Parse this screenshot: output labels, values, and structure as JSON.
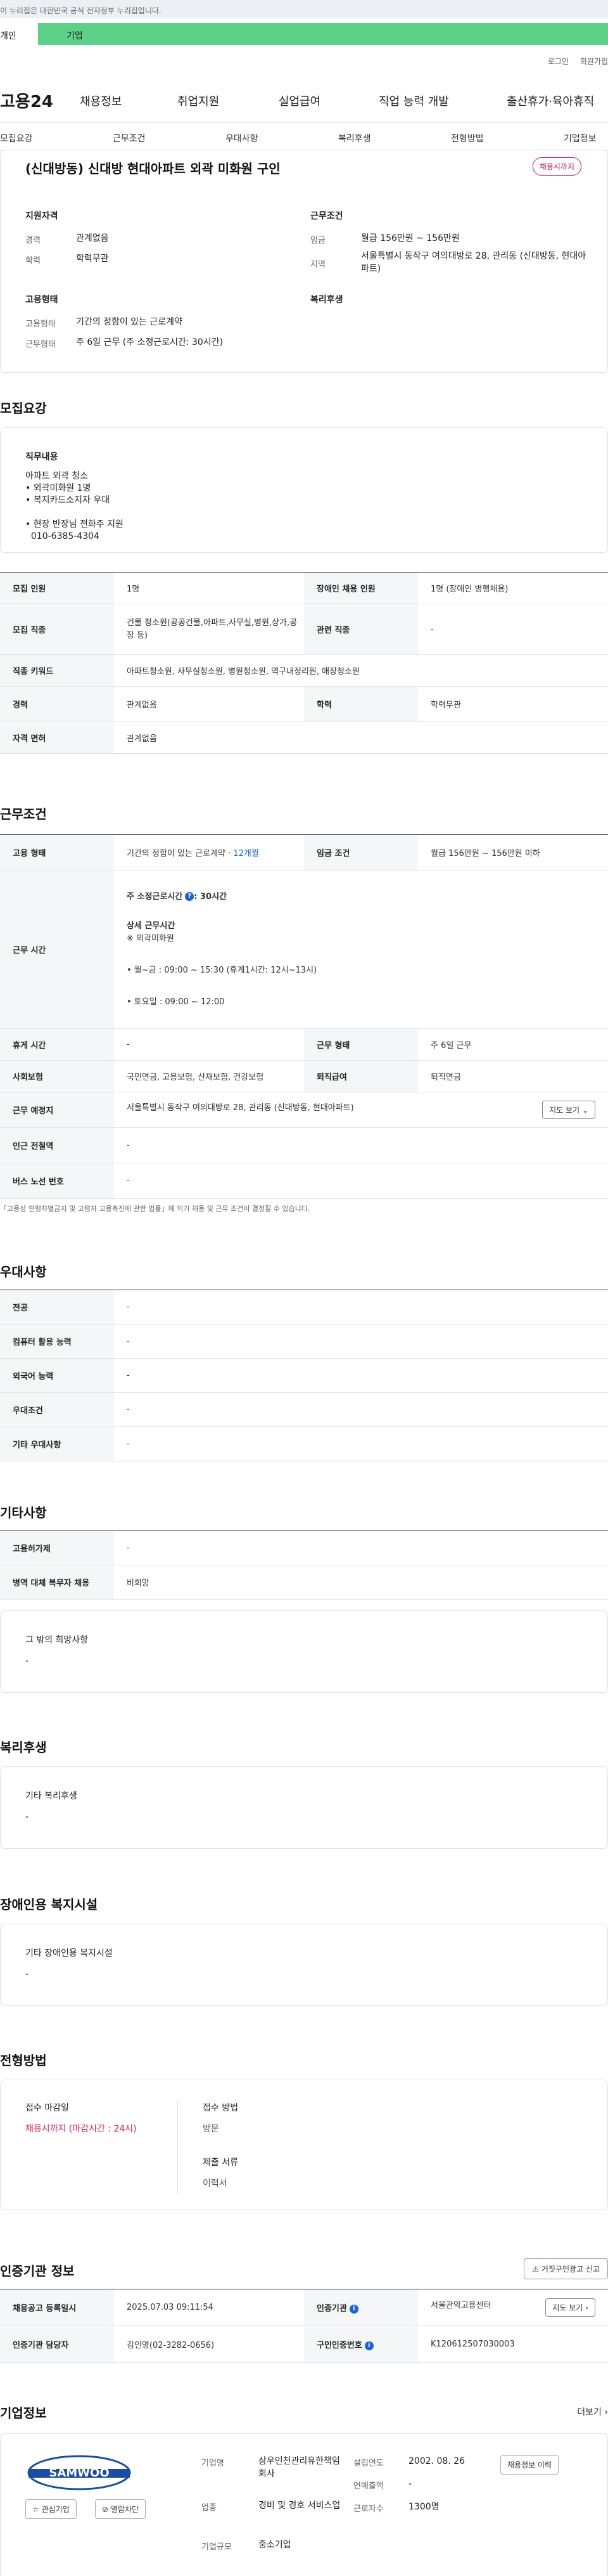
{
  "gov_banner": "이 누리집은 대한민국 공식 전자정부 누리집입니다.",
  "tabs": {
    "personal": "개인",
    "business": "기업"
  },
  "util": {
    "login": "로그인",
    "join": "회원가입"
  },
  "logo": "고용24",
  "gnb": [
    "채용정보",
    "취업지원",
    "실업급여",
    "직업 능력 개발",
    "출산휴가·육아휴직"
  ],
  "subnav": [
    "모집요강",
    "근무조건",
    "우대사항",
    "복리후생",
    "전형방법",
    "기업정보"
  ],
  "job": {
    "title": "(신대방동) 신대방 현대아파트 외곽 미화원 구인",
    "badge": "채용시까지",
    "qual_title": "지원자격",
    "career_label": "경력",
    "career": "관계없음",
    "edu_label": "학력",
    "edu": "학력무관",
    "work_title": "근무조건",
    "wage_label": "임금",
    "wage": "월급 156만원 ~ 156만원",
    "region_label": "지역",
    "region": "서울특별시 동작구 여의대방로 28, 관리동 (신대방동, 현대아파트)",
    "emp_title": "고용형태",
    "emptype_label": "고용형태",
    "emptype": "기간의 정함이 있는 근로계약",
    "worktype_label": "근무형태",
    "worktype": "주 6일 근무 (주 소정근로시간: 30시간)",
    "welfare_title": "복리후생"
  },
  "recruit": {
    "title": "모집요강",
    "duty_title": "직무내용",
    "duty_text": "아파트 외곽 청소\n• 외곽미화원 1명\n• 복지카드소지자 우대\n\n• 현장 반장님 전화주 지원\n  010-6385-4304",
    "rows": [
      {
        "k1": "모집 인원",
        "v1": "1명",
        "k2": "장애인 채용 인원",
        "v2": "1명 (장애인 병행채용)"
      },
      {
        "k1": "모집 직종",
        "v1": "건물 청소원(공공건물,아파트,사무실,병원,상가,공장 등)",
        "k2": "관련 직종",
        "v2": "-"
      },
      {
        "k1": "직종 키워드",
        "v1": "아파트청소원, 사무실청소원, 병원청소원, 역구내정리원, 매장청소원"
      },
      {
        "k1": "경력",
        "v1": "관계없음",
        "k2": "학력",
        "v2": "학력무관"
      },
      {
        "k1": "자격 면허",
        "v1": "관계없음"
      }
    ]
  },
  "work": {
    "title": "근무조건",
    "emptype_label": "고용 형태",
    "emptype": "기간의 정함이 있는 근로계약 · ",
    "emptype_period": "12개월",
    "wage_label": "임금 조건",
    "wage": "월급 156만원 ~ 156만원 이하",
    "hours_label": "근무 시간",
    "hours_head": "주 소정근로시간",
    "hours_value": ": 30시간",
    "hours_detail_title": "상세 근무시간",
    "hours_detail": "※ 외곽미화원",
    "hours_weekday": "• 월~금 : 09:00 ~ 15:30 (휴게1시간: 12시~13시)",
    "hours_sat": "• 토요일 :  09:00 ~ 12:00",
    "break_label": "휴게 시간",
    "break": "-",
    "shift_label": "근무 형태",
    "shift": "주 6일 근무",
    "insurance_label": "사회보험",
    "insurance": "국민연금, 고용보험, 산재보험, 건강보험",
    "retire_label": "퇴직급여",
    "retire": "퇴직연금",
    "place_label": "근무 예정지",
    "place": "서울특별시 동작구 여의대방로 28, 관리동 (신대방동, 현대아파트)",
    "map_btn": "지도 보기",
    "subway_label": "인근 전철역",
    "subway": "-",
    "bus_label": "버스 노선 번호",
    "bus": "-",
    "note": "「고용상 연령차별금지 및 고령자 고용촉진에 관한 법률」에 의거 채용 및 근무 조건이 결정될 수 있습니다."
  },
  "pref": {
    "title": "우대사항",
    "rows": [
      {
        "k": "전공",
        "v": "-"
      },
      {
        "k": "컴퓨터 활용 능력",
        "v": "-"
      },
      {
        "k": "외국어 능력",
        "v": "-"
      },
      {
        "k": "우대조건",
        "v": "-"
      },
      {
        "k": "기타 우대사항",
        "v": "-"
      }
    ]
  },
  "etc": {
    "title": "기타사항",
    "rows": [
      {
        "k": "고용허가제",
        "v": "-"
      },
      {
        "k": "병역 대체 복무자 채용",
        "v": "비희망"
      }
    ],
    "other_title": "그 밖의 희망사항",
    "other": "-"
  },
  "welfare": {
    "title": "복리후생",
    "box_title": "기타 복리후생",
    "box": "-"
  },
  "disabled": {
    "title": "장애인용 복지시설",
    "box_title": "기타 장애인용 복지시설",
    "box": "-"
  },
  "screening": {
    "title": "전형방법",
    "deadline_label": "접수 마감일",
    "deadline": "채용시까지 (마감시간 : 24시)",
    "method_label": "접수 방법",
    "method": "방문",
    "docs_label": "제출 서류",
    "docs": "이력서"
  },
  "agency": {
    "title": "인증기관 정보",
    "report_btn": "거짓구인광고 신고",
    "reg_label": "채용공고 등록일시",
    "reg": "2025.07.03 09:11:54",
    "agency_label": "인증기관",
    "agency": "서울관악고용센터",
    "manager_label": "인증기관 담당자",
    "manager": "김인영(02-3282-0656)",
    "num_label": "구인인증번호",
    "num": "K120612507030003",
    "map_btn": "지도 보기"
  },
  "company": {
    "title": "기업정보",
    "more": "더보기",
    "logo_text": "SAMWOO",
    "fav_btn": "관심기업",
    "block_btn": "열람차단",
    "name_label": "기업명",
    "name": "삼우인천관리유한책임회사",
    "founded_label": "설립연도",
    "founded": "2002. 08. 26",
    "sales_label": "연매출액",
    "sales": "-",
    "industry_label": "업종",
    "industry": "경비 및 경호 서비스업",
    "staff_label": "근로자수",
    "staff": "1300명",
    "size_label": "기업규모",
    "size": "중소기업",
    "history_btn": "채용정보 이력"
  }
}
